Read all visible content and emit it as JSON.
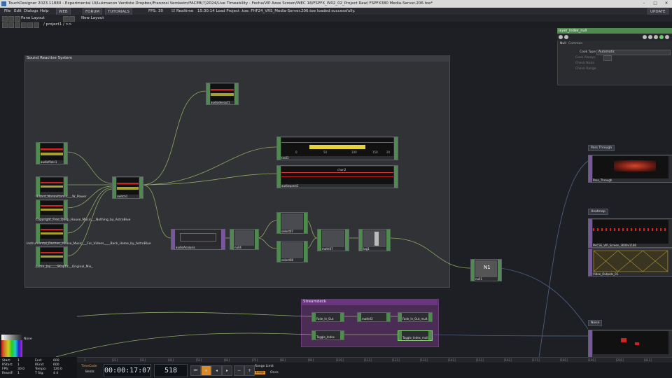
{
  "window": {
    "title": "TouchDesigner 2023.11880 - Experimental UI/Lukmanon Verdiste Dropbox/Franzosi Verdaxim/FACEB(?)2024/Live Timeability - Fecha/VIP Azee Screen/WEC 18/FSPFX_W02_02_Project Raw/ FSPFX380 Media-Server.206.toe*"
  },
  "menubar": {
    "items": [
      "File",
      "Edit",
      "Dialogs",
      "Help"
    ],
    "web_label": "WEB",
    "forum_label": "FORUM",
    "tutorials_label": "TUTORIALS",
    "fps_label": "FPS:",
    "fps_value": "30",
    "realtime_label": "Realtime",
    "status": "15:30:14 Load Project .toe: FHF24_VRS_Media-Server.206.toe loaded successfully.",
    "update_label": "UPDATE"
  },
  "toolbar": {
    "pane1": "Pane Layout",
    "pane2": "New Layout"
  },
  "path": {
    "text": "/ project1 / >>"
  },
  "panels": {
    "sound_reactive": "Sound Reactive System",
    "streamdeck": "Streamdeck",
    "pass_through": "Pass Through",
    "heatmap": "Heatmap",
    "noise": "Noise"
  },
  "operators": {
    "audiodevout1": "audiodevout1",
    "audiofile1": "audiofileIn1",
    "audiofile2": "Hillard_Nanavitamin___W_Power",
    "audiofile3": "Copyright_Free_Deep_House_Music___Nothing_by_AstroBlue",
    "audiofile4": "Instrumental_Deshen_House_Music___For_Videos____Back_Home_by_AstroBlue",
    "audiofile5": "Justin_Jay____SKaptic__Original_Mix_",
    "switch1": "switch1",
    "trail1": "trail1",
    "audiospect1": "audiospect1",
    "audioanalysis": "audioAnalysis",
    "null4": "null4",
    "select1": "select07",
    "select2": "select08",
    "math": "math07",
    "lag": "lag1",
    "null1": "null1",
    "passthrough": "Pass_Through",
    "heatmap_op": "PHCSE_VIP_Screen_3600x1180",
    "video_outputs": "Video_Outputs_01",
    "sd_fade": "Fade_In_Out",
    "sd_math": "math03",
    "sd_fade2": "Fade_In_Out_mult",
    "sd_toggle": "Toggle_Index",
    "sd_toggle2": "Toggle_Index_mult",
    "chan2": "chan2",
    "ticks_trail": [
      "0",
      "50",
      "100",
      "150",
      "20"
    ]
  },
  "param": {
    "title": "layer_index_null",
    "tab1": "Null",
    "tab2": "Common",
    "cook_label": "Cook Type",
    "cook_value": "Automatic",
    "p1": "Cook Always",
    "p2": "Check Node",
    "p3": "Check Range"
  },
  "timeline": {
    "ticks": [
      "1",
      "[21]",
      "[31]",
      "[41]",
      "[51]",
      "[61]",
      "[71]",
      "[81]",
      "[91]",
      "[101]",
      "[111]",
      "[121]",
      "[131]",
      "[141]",
      "[151]",
      "[161]",
      "[171]",
      "[181]",
      "[191]",
      "[201]",
      "[411]"
    ]
  },
  "stats": {
    "start_label": "Start:",
    "start_value": "1",
    "end_label": "End:",
    "end_value": "600",
    "rstart_label": "RStart:",
    "rstart_value": "1",
    "rend_label": "REnd:",
    "rend_value": "600",
    "fps_label": "FPS:",
    "fps_value": "30.0",
    "tempo_label": "Tempo:",
    "tempo_value": "120.0",
    "reset_label": "ResetF:",
    "reset_value": "1",
    "tsig_label": "T Sig:",
    "tsig_value": "4   4",
    "none_label": "None"
  },
  "transport": {
    "timecode_label": "TimeCode",
    "beats_label": "Beats",
    "timecode": "00:00:17:07",
    "frame": "518",
    "range_label": "Range Limit",
    "loop_label": "Loop",
    "once_label": "Once"
  },
  "colors": {
    "chop_green": "#4f8a4f",
    "comp_purple": "#7a56a0",
    "wire": "#9bb56a",
    "streamdeck_purple": "#6b3680"
  }
}
